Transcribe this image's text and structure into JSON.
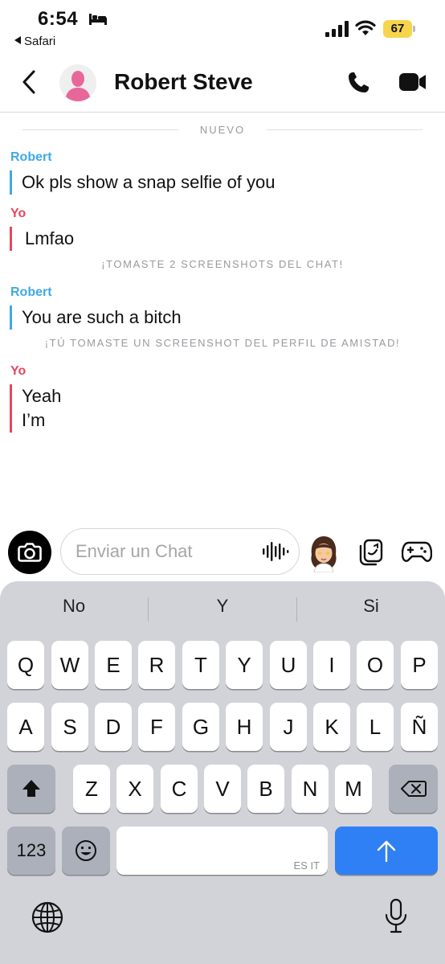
{
  "status_bar": {
    "time": "6:54",
    "back_app": "Safari",
    "battery": "67",
    "battery_color": "#f6d54c"
  },
  "header": {
    "contact_name": "Robert Steve",
    "icons": [
      "chevron-left-icon",
      "avatar",
      "phone-icon",
      "video-camera-icon"
    ]
  },
  "chat": {
    "new_divider": "NUEVO",
    "sender_colors": {
      "robert": "#3fa9e6",
      "yo": "#e5485b"
    },
    "messages": [
      {
        "sender": "Robert",
        "text": "Ok pls show a snap selfie of you"
      },
      {
        "sender": "Yo",
        "text": "Lmfao"
      },
      {
        "notice": "¡TOMASTE 2 SCREENSHOTS DEL CHAT!"
      },
      {
        "sender": "Robert",
        "text": "You are such a bitch"
      },
      {
        "notice": "¡TÚ TOMASTE UN SCREENSHOT DEL PERFIL DE AMISTAD!"
      },
      {
        "sender": "Yo",
        "lines": [
          "Yeah",
          "I’m"
        ]
      }
    ]
  },
  "input": {
    "placeholder": "Enviar un Chat",
    "value": ""
  },
  "keyboard": {
    "suggestions": [
      "No",
      "Y",
      "Si"
    ],
    "row1": [
      "Q",
      "W",
      "E",
      "R",
      "T",
      "Y",
      "U",
      "I",
      "O",
      "P"
    ],
    "row2": [
      "A",
      "S",
      "D",
      "F",
      "G",
      "H",
      "J",
      "K",
      "L",
      "Ñ"
    ],
    "row3": [
      "Z",
      "X",
      "C",
      "V",
      "B",
      "N",
      "M"
    ],
    "numbers_label": "123",
    "space_lang": "ES IT",
    "send_color": "#2f7ff5"
  }
}
